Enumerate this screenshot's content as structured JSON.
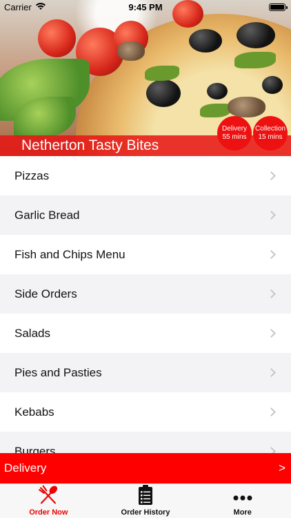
{
  "status_bar": {
    "carrier": "Carrier",
    "time": "9:45 PM"
  },
  "restaurant": {
    "name": "Netherton Tasty Bites"
  },
  "badges": {
    "delivery": {
      "label": "Delivery",
      "time": "55 mins"
    },
    "collection": {
      "label": "Collection",
      "time": "15 mins"
    }
  },
  "menu": {
    "items": [
      {
        "label": "Pizzas"
      },
      {
        "label": "Garlic Bread"
      },
      {
        "label": "Fish and Chips Menu"
      },
      {
        "label": "Side Orders"
      },
      {
        "label": "Salads"
      },
      {
        "label": "Pies and Pasties"
      },
      {
        "label": "Kebabs"
      },
      {
        "label": "Burgers"
      }
    ]
  },
  "delivery_bar": {
    "label": "Delivery",
    "arrow": ">"
  },
  "tabs": [
    {
      "label": "Order Now",
      "icon": "fork-knife-icon",
      "active": true
    },
    {
      "label": "Order History",
      "icon": "clipboard-list-icon",
      "active": false
    },
    {
      "label": "More",
      "icon": "more-dots-icon",
      "active": false
    }
  ],
  "colors": {
    "accent": "#ff0000",
    "tab_active": "#e00000"
  }
}
